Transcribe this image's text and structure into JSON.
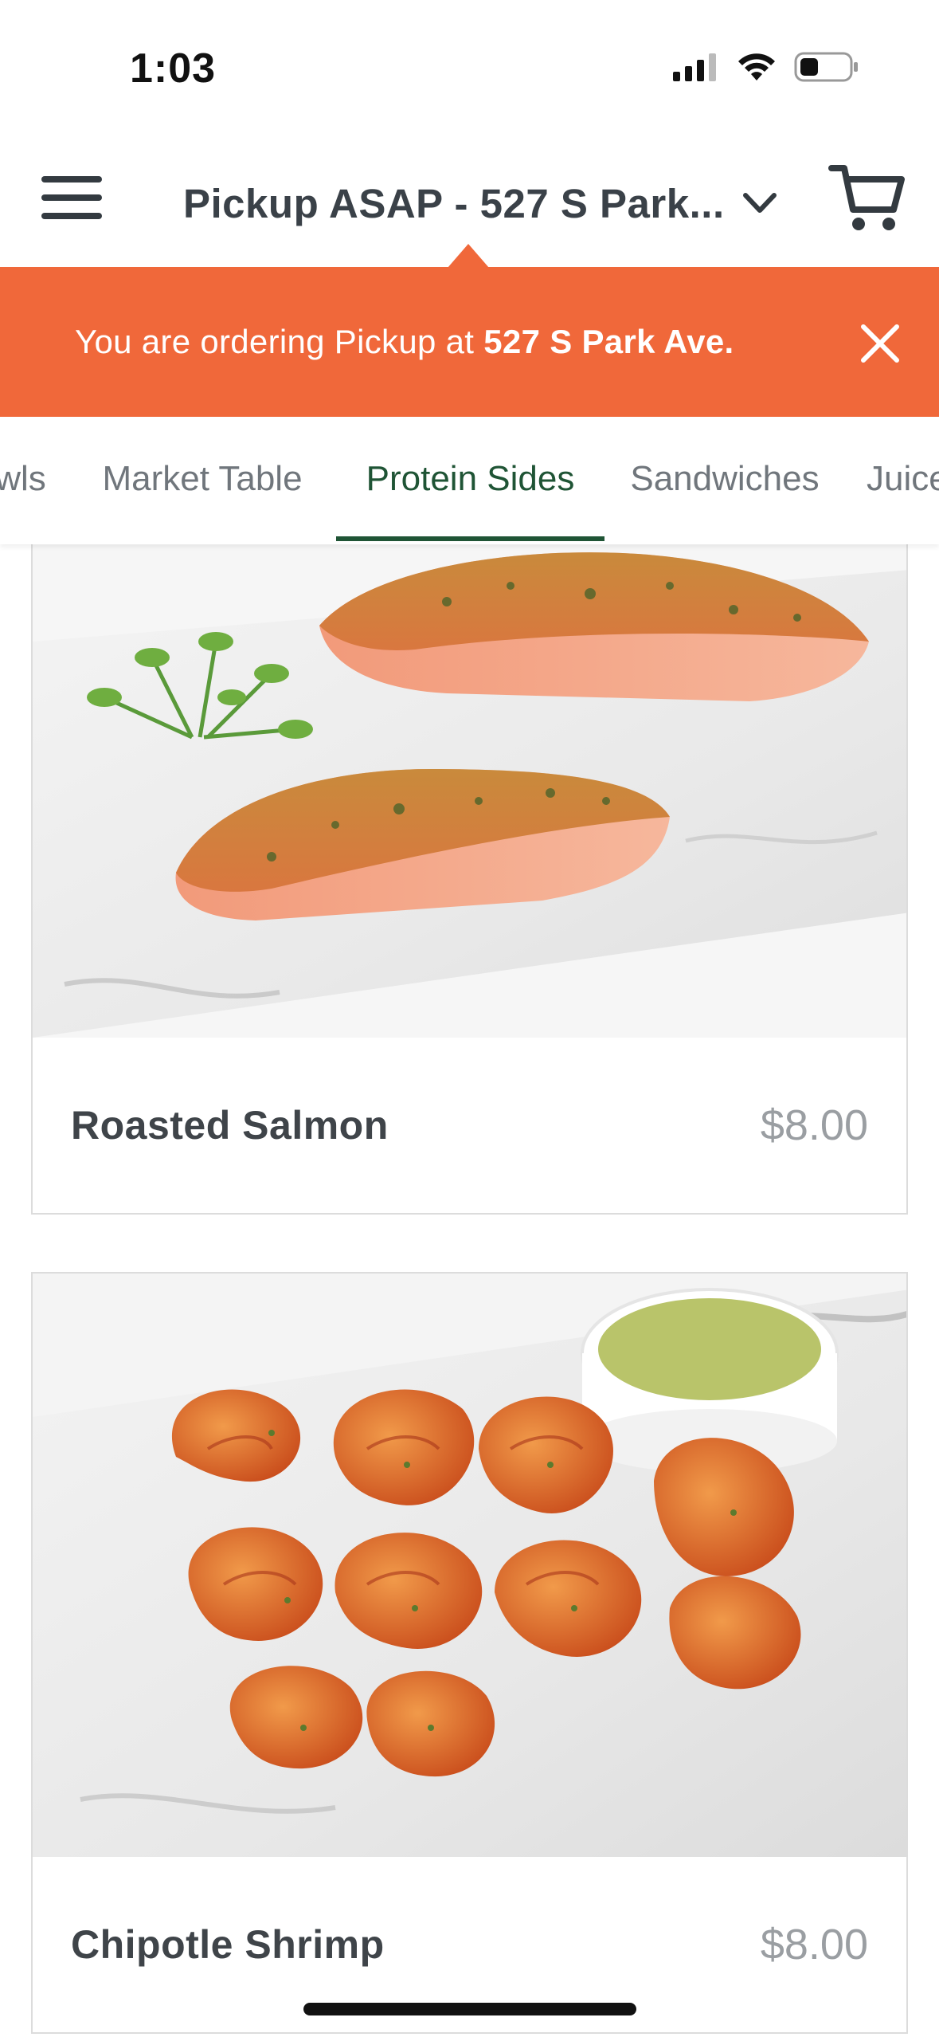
{
  "status_bar": {
    "time": "1:03",
    "icons": [
      "cellular-signal-icon",
      "wifi-icon",
      "battery-icon"
    ]
  },
  "header": {
    "menu_icon": "hamburger-menu-icon",
    "location_label": "Pickup ASAP - 527 S Park...",
    "dropdown_icon": "chevron-down-icon",
    "cart_icon": "shopping-cart-icon"
  },
  "banner": {
    "message_prefix": "You are ordering Pickup at",
    "address": "527 S Park Ave.",
    "close_icon": "close-icon",
    "color": "#f0683a"
  },
  "tabs": {
    "items": [
      {
        "label": "wls"
      },
      {
        "label": "Market Table"
      },
      {
        "label": "Protein Sides"
      },
      {
        "label": "Sandwiches"
      },
      {
        "label": "Juice"
      }
    ],
    "active_index": 2,
    "active_color": "#1f5435"
  },
  "menu_items": [
    {
      "name": "Roasted Salmon",
      "price": "$8.00"
    },
    {
      "name": "Chipotle Shrimp",
      "price": "$8.00"
    }
  ]
}
